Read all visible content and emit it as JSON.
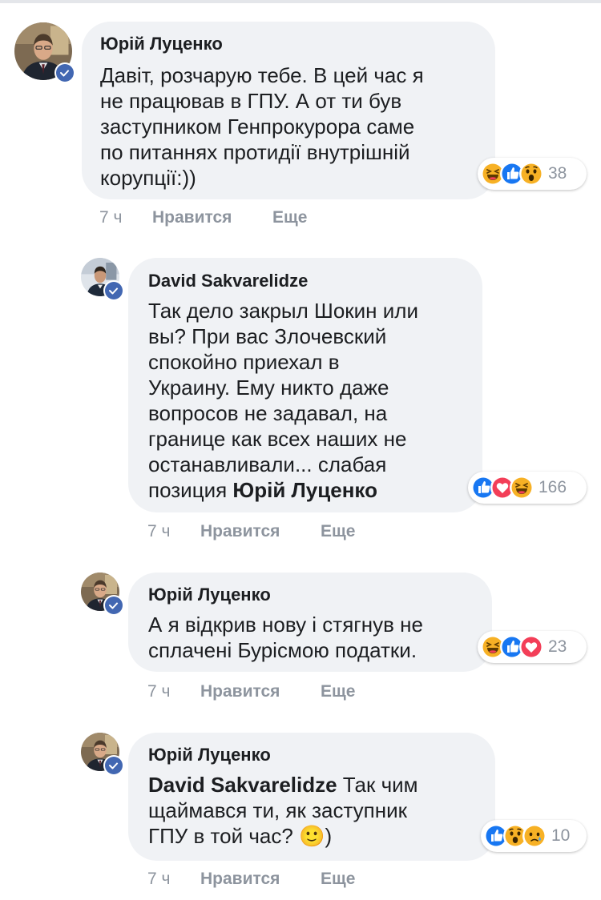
{
  "comments": [
    {
      "author": "Юрій Луценко",
      "lines": [
        "Давіт, розчарую тебе. В цей час я",
        "не працював в ГПУ. А от ти був",
        "заступником Генпрокурора саме",
        "по питаннях протидії внутрішній",
        "корупції:))"
      ],
      "reactions": [
        "haha",
        "like",
        "wow"
      ],
      "reaction_count": "38",
      "time": "7 ч",
      "like_label": "Нравится",
      "reply_label": "Еще"
    },
    {
      "author": "David Sakvarelidze",
      "lines": [
        "Так дело закрыл Шокин или",
        "вы? При вас Злочевский",
        "спокойно приехал в",
        "Украину. Ему никто даже",
        "вопросов не задавал, на",
        "границе как всех наших не",
        "останавливали... слабая"
      ],
      "last_line_prefix": "позиция ",
      "last_line_mention": "Юрій Луценко",
      "reactions": [
        "like",
        "love",
        "haha"
      ],
      "reaction_count": "166",
      "time": "7 ч",
      "like_label": "Нравится",
      "reply_label": "Еще"
    },
    {
      "author": "Юрій Луценко",
      "lines": [
        "А я відкрив нову і стягнув не",
        "сплачені Бурісмою податки."
      ],
      "reactions": [
        "haha",
        "like",
        "love"
      ],
      "reaction_count": "23",
      "time": "7 ч",
      "like_label": "Нравится",
      "reply_label": "Еще"
    },
    {
      "author": "Юрій Луценко",
      "first_line_mention": "David Sakvarelidze",
      "first_line_rest": " Так чим",
      "lines": [
        "щаймався ти, як заступник"
      ],
      "last_line_prefix": "ГПУ в той час? ",
      "emoji": "🙂",
      "last_line_suffix": ")",
      "reactions": [
        "like",
        "wow",
        "sad"
      ],
      "reaction_count": "10",
      "time": "7 ч",
      "like_label": "Нравится",
      "reply_label": "Еще"
    }
  ],
  "colors": {
    "bubble": "#f0f2f5",
    "meta": "#8d949e",
    "verified": "#4267b2",
    "like": "#1877f2",
    "love": "#f33e58",
    "haha_yellow": "#f7b125"
  }
}
